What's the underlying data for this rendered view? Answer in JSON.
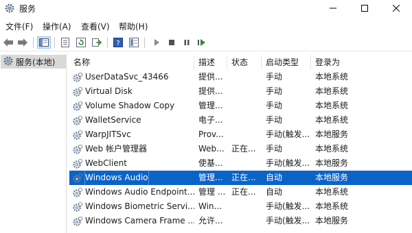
{
  "window": {
    "title": "服务",
    "minimize_glyph": "—",
    "maximize_glyph": "☐",
    "close_glyph": "✕"
  },
  "menu": [
    "文件(F)",
    "操作(A)",
    "查看(V)",
    "帮助(H)"
  ],
  "toolbar": {
    "buttons": [
      "back-icon",
      "forward-icon",
      "console-tree-icon",
      "properties-icon",
      "refresh-icon",
      "export-icon",
      "help-icon",
      "show-hide-icon",
      "start-icon",
      "stop-icon",
      "pause-icon",
      "restart-icon"
    ]
  },
  "tree": {
    "label": "服务(本地)"
  },
  "table": {
    "headers": {
      "name": "名称",
      "desc": "描述",
      "status": "状态",
      "start": "启动类型",
      "logon": "登录为"
    },
    "rows": [
      {
        "name": "UserDataSvc_43466",
        "desc": "提供...",
        "status": "",
        "start": "手动",
        "logon": "本地系统"
      },
      {
        "name": "Virtual Disk",
        "desc": "提供...",
        "status": "",
        "start": "手动",
        "logon": "本地系统"
      },
      {
        "name": "Volume Shadow Copy",
        "desc": "管理...",
        "status": "",
        "start": "手动",
        "logon": "本地系统"
      },
      {
        "name": "WalletService",
        "desc": "电子...",
        "status": "",
        "start": "手动",
        "logon": "本地系统"
      },
      {
        "name": "WarpJITSvc",
        "desc": "Prov...",
        "status": "",
        "start": "手动(触发...",
        "logon": "本地服务"
      },
      {
        "name": "Web 帐户管理器",
        "desc": "Web...",
        "status": "正在...",
        "start": "手动",
        "logon": "本地系统"
      },
      {
        "name": "WebClient",
        "desc": "使基...",
        "status": "",
        "start": "手动(触发...",
        "logon": "本地服务"
      },
      {
        "name": "Windows Audio",
        "desc": "管理...",
        "status": "正在...",
        "start": "自动",
        "logon": "本地服务"
      },
      {
        "name": "Windows Audio Endpoint...",
        "desc": "管理 ...",
        "status": "正在...",
        "start": "自动",
        "logon": "本地系统"
      },
      {
        "name": "Windows Biometric Servi...",
        "desc": "Win...",
        "status": "",
        "start": "手动(触发...",
        "logon": "本地系统"
      },
      {
        "name": "Windows Camera Frame ...",
        "desc": "允许...",
        "status": "",
        "start": "手动(触发...",
        "logon": "本地服务"
      }
    ],
    "selected_index": 7
  },
  "colors": {
    "selection": "#0a64c8",
    "tree_selected": "#d9d9d9",
    "play_green": "#2e8b2e"
  }
}
